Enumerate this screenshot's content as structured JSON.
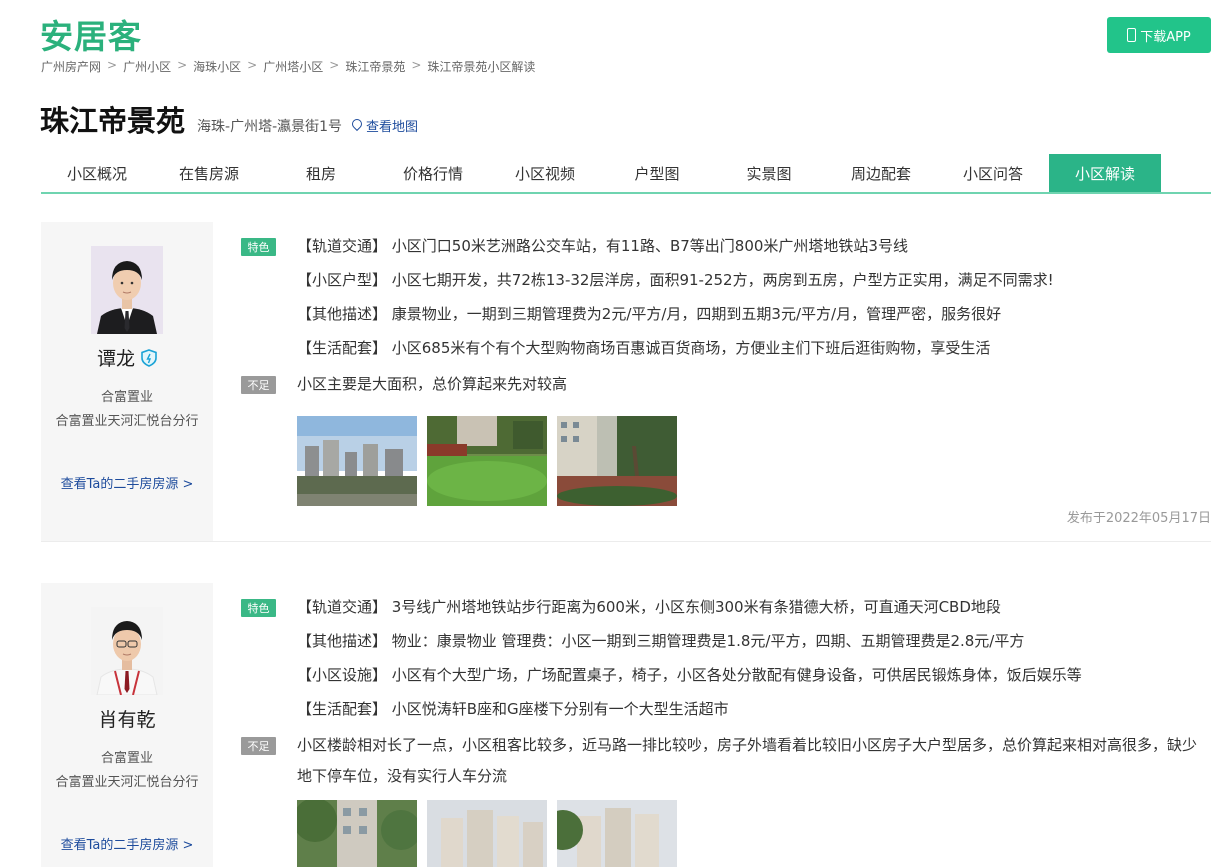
{
  "header": {
    "logo": "安居客",
    "download_label": "下载APP"
  },
  "breadcrumb": [
    "广州房产网",
    "广州小区",
    "海珠小区",
    "广州塔小区",
    "珠江帝景苑",
    "珠江帝景苑小区解读"
  ],
  "title": {
    "name": "珠江帝景苑",
    "address": "海珠-广州塔-瀛景街1号",
    "map_link": "查看地图"
  },
  "nav": {
    "tabs": [
      "小区概况",
      "在售房源",
      "租房",
      "价格行情",
      "小区视频",
      "户型图",
      "实景图",
      "周边配套",
      "小区问答",
      "小区解读"
    ],
    "active_index": 9
  },
  "reviews": [
    {
      "agent": {
        "name": "谭龙",
        "company": "合富置业",
        "branch": "合富置业天河汇悦台分行",
        "link": "查看Ta的二手房房源 >"
      },
      "feature_tag": "特色",
      "features": [
        "【轨道交通】 小区门口50米艺洲路公交车站，有11路、B7等出门800米广州塔地铁站3号线",
        "【小区户型】 小区七期开发，共72栋13-32层洋房，面积91-252方，两房到五房，户型方正实用，满足不同需求!",
        "【其他描述】 康景物业，一期到三期管理费为2元/平方/月，四期到五期3元/平方/月，管理严密，服务很好",
        "【生活配套】 小区685米有个有个大型购物商场百惠诚百货商场，方便业主们下班后逛街购物，享受生活"
      ],
      "weakness_tag": "不足",
      "weakness": "小区主要是大面积，总价算起来先对较高",
      "published": "发布于2022年05月17日"
    },
    {
      "agent": {
        "name": "肖有乾",
        "company": "合富置业",
        "branch": "合富置业天河汇悦台分行",
        "link": "查看Ta的二手房房源 >"
      },
      "feature_tag": "特色",
      "features": [
        "【轨道交通】 3号线广州塔地铁站步行距离为600米，小区东侧300米有条猎德大桥，可直通天河CBD地段",
        "【其他描述】 物业：康景物业 管理费：小区一期到三期管理费是1.8元/平方，四期、五期管理费是2.8元/平方",
        "【小区设施】 小区有个大型广场，广场配置桌子，椅子，小区各处分散配有健身设备，可供居民锻炼身体，饭后娱乐等",
        "【生活配套】 小区悦涛轩B座和G座楼下分别有一个大型生活超市"
      ],
      "weakness_tag": "不足",
      "weakness": "小区楼龄相对长了一点，小区租客比较多，近马路一排比较吵，房子外墙看着比较旧小区房子大户型居多，总价算起来相对高很多，缺少地下停车位，没有实行人车分流"
    }
  ],
  "colors": {
    "brand": "#2bb17c",
    "accent": "#2bb488",
    "link": "#1d4b9c",
    "tag_feature": "#3ab886",
    "tag_weak": "#9a9a9a"
  }
}
